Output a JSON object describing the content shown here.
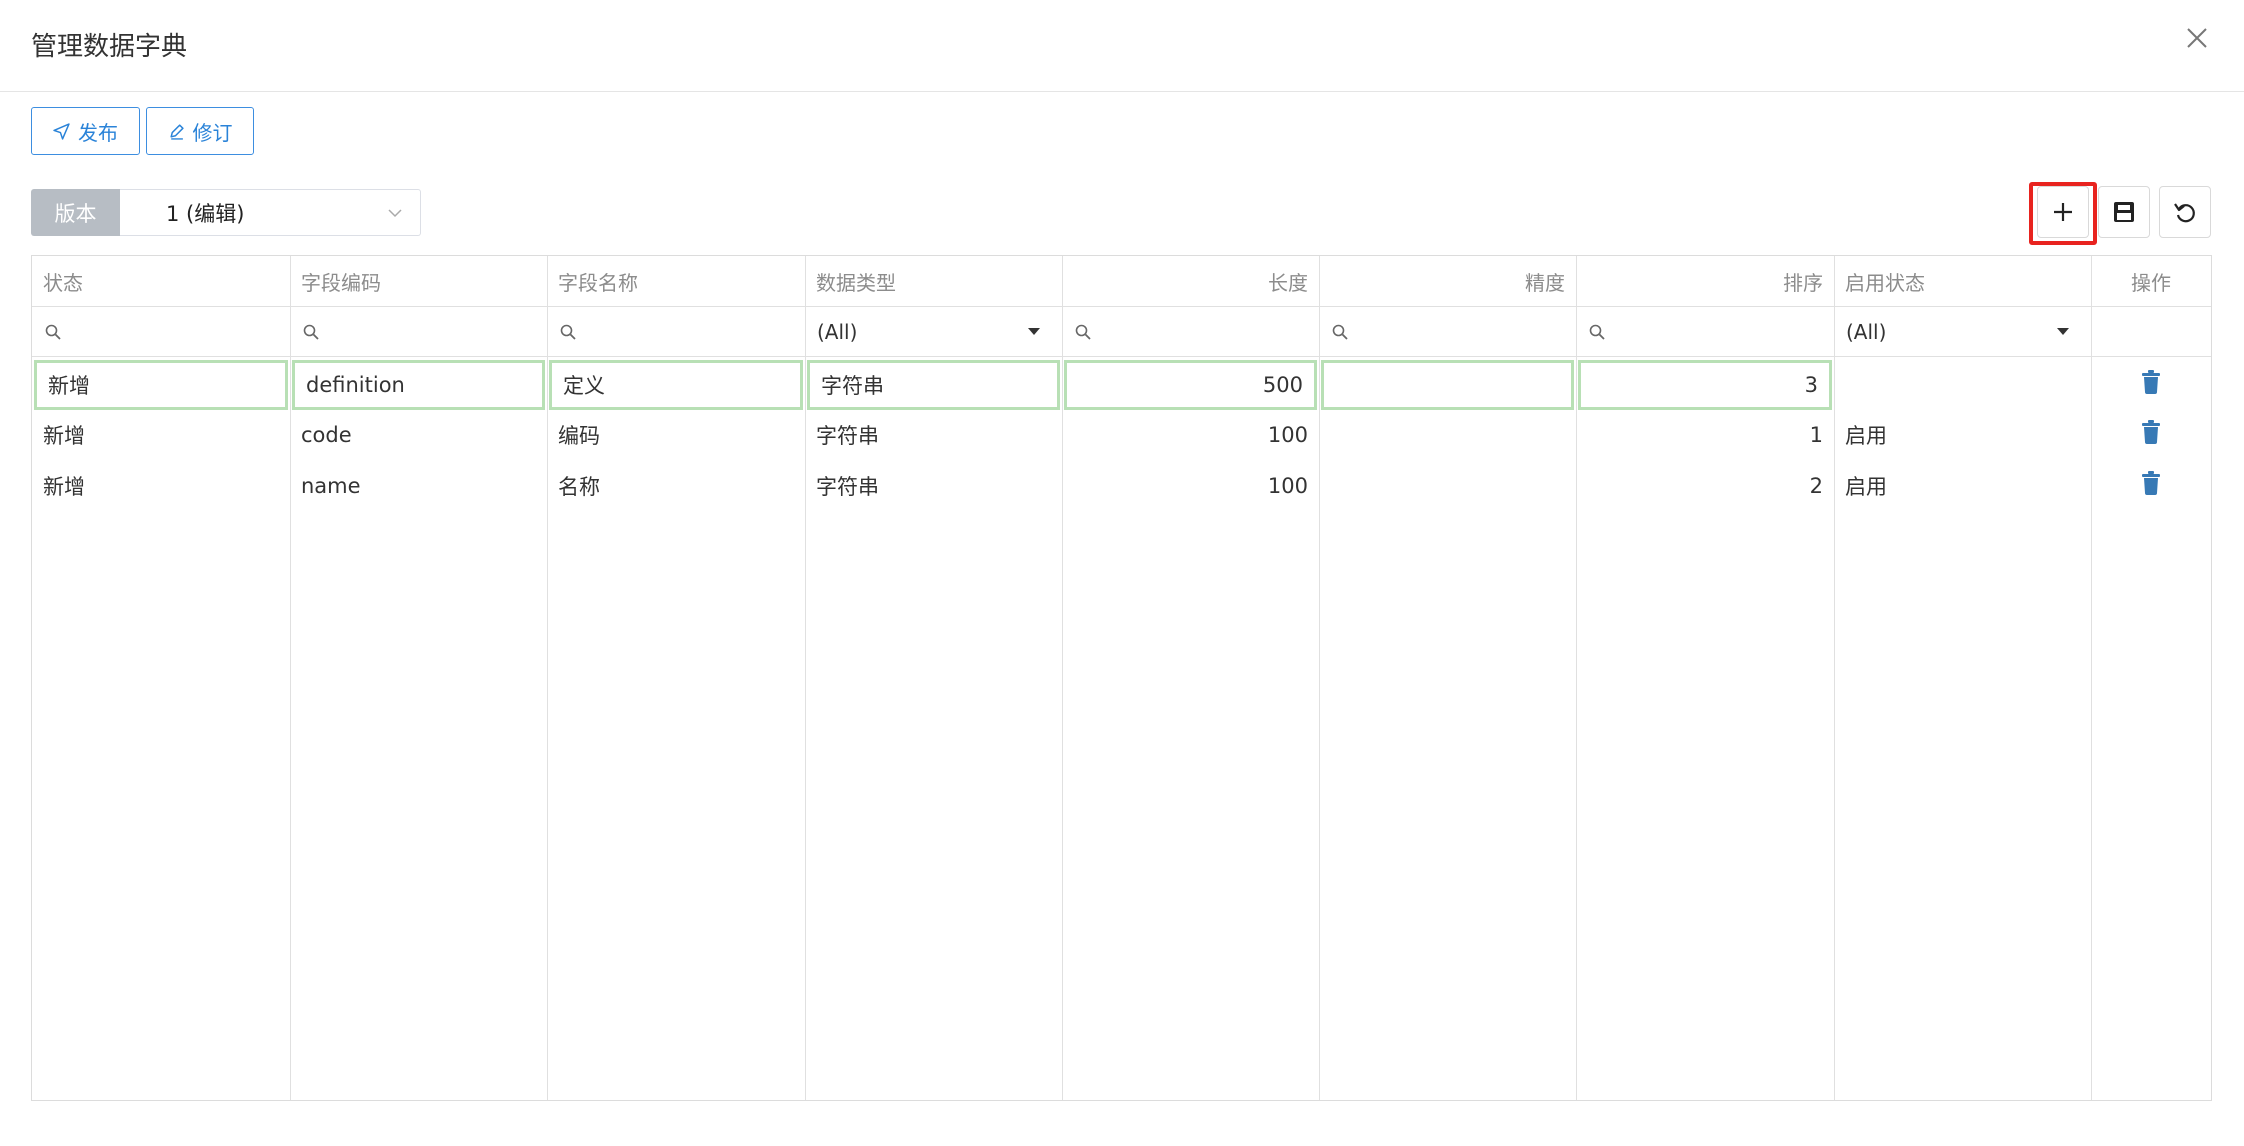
{
  "dialog": {
    "title": "管理数据字典"
  },
  "toolbar": {
    "publish_label": "发布",
    "revise_label": "修订"
  },
  "version": {
    "label": "版本",
    "selected": "1 (编辑)"
  },
  "grid_actions": {
    "add": "plus-icon",
    "save": "save-icon",
    "undo": "undo-icon"
  },
  "columns": [
    "状态",
    "字段编码",
    "字段名称",
    "数据类型",
    "长度",
    "精度",
    "排序",
    "启用状态",
    "操作"
  ],
  "filters": {
    "data_type": "(All)",
    "enable_status": "(All)"
  },
  "rows": [
    {
      "status": "新增",
      "code": "definition",
      "name": "定义",
      "type": "字符串",
      "length": "500",
      "precision": "",
      "order": "3",
      "enabled": ""
    },
    {
      "status": "新增",
      "code": "code",
      "name": "编码",
      "type": "字符串",
      "length": "100",
      "precision": "",
      "order": "1",
      "enabled": "启用"
    },
    {
      "status": "新增",
      "code": "name",
      "name": "名称",
      "type": "字符串",
      "length": "100",
      "precision": "",
      "order": "2",
      "enabled": "启用"
    }
  ],
  "colors": {
    "accent": "#2a83d8",
    "highlight": "#e8231f",
    "edited_border": "#b8e0b5",
    "trash": "#3779b5"
  }
}
